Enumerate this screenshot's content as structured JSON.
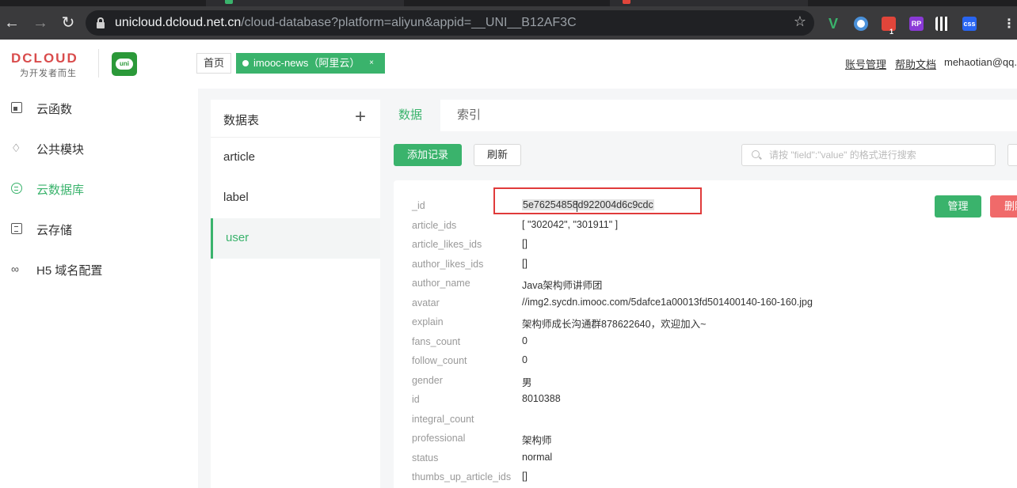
{
  "browser": {
    "url_host": "unicloud.dcloud.net.cn",
    "url_path": "/cloud-database?platform=aliyun&appid=__UNI__B12AF3C",
    "extension_badge": "1",
    "ext_rp_label": "RP",
    "ext_css_label": "css"
  },
  "header": {
    "logo_text": "DCLOUD",
    "logo_slogan": "为开发者而生",
    "uni_logo_text": "uni",
    "home_tab": "首页",
    "active_tab": "imooc-news（阿里云）",
    "active_tab_close": "×",
    "account_link": "账号管理",
    "help_link": "帮助文档",
    "user_email": "mehaotian@qq.c"
  },
  "sidebar": {
    "items": [
      {
        "label": "云函数",
        "icon": "cloud-function-icon"
      },
      {
        "label": "公共模块",
        "icon": "layers-icon"
      },
      {
        "label": "云数据库",
        "icon": "database-icon"
      },
      {
        "label": "云存储",
        "icon": "storage-icon"
      },
      {
        "label": "H5 域名配置",
        "icon": "link-icon"
      }
    ],
    "active_index": 2
  },
  "tables": {
    "title": "数据表",
    "add_symbol": "+",
    "items": [
      "article",
      "label",
      "user"
    ],
    "active": "user"
  },
  "main": {
    "tabs": [
      "数据",
      "索引"
    ],
    "active_tab": "数据",
    "add_button": "添加记录",
    "refresh_button": "刷新",
    "search_placeholder": "请按 \"field\":\"value\" 的格式进行搜索",
    "manage_button": "管理",
    "delete_button": "删除"
  },
  "record": {
    "fields": [
      {
        "key": "_id",
        "value": "5e76254858d922004d6c9cdc"
      },
      {
        "key": "article_ids",
        "value": "[ \"302042\", \"301911\" ]"
      },
      {
        "key": "article_likes_ids",
        "value": "[]"
      },
      {
        "key": "author_likes_ids",
        "value": "[]"
      },
      {
        "key": "author_name",
        "value": "Java架构师讲师团"
      },
      {
        "key": "avatar",
        "value": "//img2.sycdn.imooc.com/5dafce1a00013fd501400140-160-160.jpg"
      },
      {
        "key": "explain",
        "value": "架构师成长沟通群878622640，欢迎加入~"
      },
      {
        "key": "fans_count",
        "value": "0"
      },
      {
        "key": "follow_count",
        "value": "0"
      },
      {
        "key": "gender",
        "value": "男"
      },
      {
        "key": "id",
        "value": "8010388"
      },
      {
        "key": "integral_count",
        "value": ""
      },
      {
        "key": "professional",
        "value": "架构师"
      },
      {
        "key": "status",
        "value": "normal"
      },
      {
        "key": "thumbs_up_article_ids",
        "value": "[]"
      }
    ]
  },
  "colors": {
    "accent": "#3ab36c",
    "danger": "#f06a6a",
    "highlight_box": "#e03b3b"
  }
}
